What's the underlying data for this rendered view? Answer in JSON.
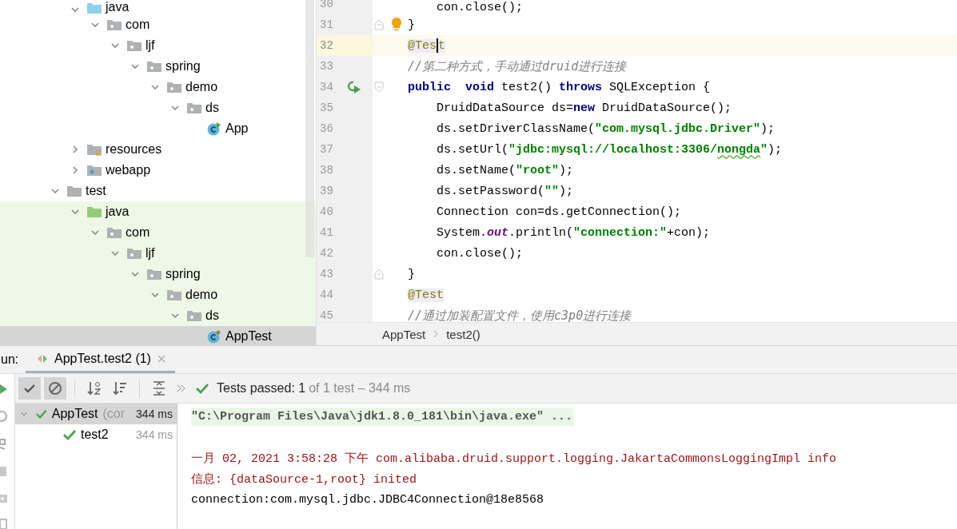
{
  "project_tree": {
    "items": [
      {
        "children": [
          {
            "label": "java",
            "kind": "source-root",
            "expanded": true,
            "selected": false,
            "children": [
              {
                "label": "com",
                "kind": "package",
                "expanded": true,
                "selected": false,
                "children": [
                  {
                    "label": "ljf",
                    "kind": "package",
                    "expanded": true,
                    "selected": false,
                    "children": [
                      {
                        "label": "spring",
                        "kind": "package",
                        "expanded": true,
                        "selected": false,
                        "children": [
                          {
                            "label": "demo",
                            "kind": "package",
                            "expanded": true,
                            "selected": false,
                            "children": [
                              {
                                "label": "ds",
                                "kind": "package",
                                "expanded": true,
                                "selected": false,
                                "children": [
                                  {
                                    "label": "App",
                                    "kind": "main-class",
                                    "selected": false
                                  }
                                ]
                              }
                            ]
                          }
                        ]
                      }
                    ]
                  }
                ]
              }
            ]
          },
          {
            "label": "resources",
            "kind": "resources",
            "expanded": false,
            "selected": false
          },
          {
            "label": "webapp",
            "kind": "webapp",
            "expanded": false,
            "selected": false
          }
        ]
      },
      {
        "label": "test",
        "kind": "folder",
        "expanded": true,
        "selected": false,
        "children": [
          {
            "label": "java",
            "kind": "test-root",
            "expanded": true,
            "selected": false,
            "children": [
              {
                "label": "com",
                "kind": "package",
                "expanded": true,
                "selected": false,
                "children": [
                  {
                    "label": "ljf",
                    "kind": "package",
                    "expanded": true,
                    "selected": false,
                    "children": [
                      {
                        "label": "spring",
                        "kind": "package",
                        "expanded": true,
                        "selected": false,
                        "children": [
                          {
                            "label": "demo",
                            "kind": "package",
                            "expanded": true,
                            "selected": false,
                            "children": [
                              {
                                "label": "ds",
                                "kind": "package",
                                "expanded": true,
                                "selected": false,
                                "children": [
                                  {
                                    "label": "AppTest",
                                    "kind": "test-class",
                                    "selected": true
                                  }
                                ]
                              }
                            ]
                          }
                        ]
                      }
                    ]
                  }
                ]
              }
            ]
          }
        ]
      }
    ]
  },
  "editor": {
    "lines": [
      {
        "number": "30",
        "current": false,
        "fold_start": false,
        "fold_end": false,
        "runnable": false,
        "bulb": false,
        "tokens": [
          {
            "kind": "plain",
            "text": "    con.close();"
          }
        ]
      },
      {
        "number": "31",
        "current": false,
        "fold_start": false,
        "fold_end": true,
        "runnable": false,
        "bulb": true,
        "tokens": [
          {
            "kind": "plain",
            "text": "}"
          }
        ]
      },
      {
        "number": "32",
        "current": true,
        "fold_start": false,
        "fold_end": false,
        "runnable": false,
        "bulb": false,
        "tokens": [
          {
            "kind": "annotation",
            "text": "@Tes"
          },
          {
            "kind": "caret"
          },
          {
            "kind": "annotation",
            "text": "t"
          }
        ]
      },
      {
        "number": "33",
        "current": false,
        "fold_start": false,
        "fold_end": false,
        "runnable": false,
        "bulb": false,
        "tokens": [
          {
            "kind": "comment",
            "text": "//第二种方式，手动通过druid进行连接"
          }
        ]
      },
      {
        "number": "34",
        "current": false,
        "fold_start": true,
        "fold_end": false,
        "runnable": true,
        "bulb": false,
        "tokens": [
          {
            "kind": "keyword",
            "text": "public  void"
          },
          {
            "kind": "plain",
            "text": " test2() "
          },
          {
            "kind": "keyword",
            "text": "throws"
          },
          {
            "kind": "plain",
            "text": " SQLException {"
          }
        ]
      },
      {
        "number": "35",
        "current": false,
        "fold_start": false,
        "fold_end": false,
        "runnable": false,
        "bulb": false,
        "tokens": [
          {
            "kind": "plain",
            "text": "    DruidDataSource ds="
          },
          {
            "kind": "keyword",
            "text": "new"
          },
          {
            "kind": "plain",
            "text": " DruidDataSource();"
          }
        ]
      },
      {
        "number": "36",
        "current": false,
        "fold_start": false,
        "fold_end": false,
        "runnable": false,
        "bulb": false,
        "tokens": [
          {
            "kind": "plain",
            "text": "    ds.setDriverClassName("
          },
          {
            "kind": "string",
            "text": "\"com.mysql.jdbc.Driver\""
          },
          {
            "kind": "plain",
            "text": ");"
          }
        ]
      },
      {
        "number": "37",
        "current": false,
        "fold_start": false,
        "fold_end": false,
        "runnable": false,
        "bulb": false,
        "tokens": [
          {
            "kind": "plain",
            "text": "    ds.setUrl("
          },
          {
            "kind": "string",
            "text": "\"jdbc:mysql://localhost:3306/"
          },
          {
            "kind": "string-misspelled",
            "text": "nongda"
          },
          {
            "kind": "string",
            "text": "\""
          },
          {
            "kind": "plain",
            "text": ");"
          }
        ]
      },
      {
        "number": "38",
        "current": false,
        "fold_start": false,
        "fold_end": false,
        "runnable": false,
        "bulb": false,
        "tokens": [
          {
            "kind": "plain",
            "text": "    ds.setName("
          },
          {
            "kind": "string",
            "text": "\"root\""
          },
          {
            "kind": "plain",
            "text": ");"
          }
        ]
      },
      {
        "number": "39",
        "current": false,
        "fold_start": false,
        "fold_end": false,
        "runnable": false,
        "bulb": false,
        "tokens": [
          {
            "kind": "plain",
            "text": "    ds.setPassword("
          },
          {
            "kind": "string",
            "text": "\"\""
          },
          {
            "kind": "plain",
            "text": ");"
          }
        ]
      },
      {
        "number": "40",
        "current": false,
        "fold_start": false,
        "fold_end": false,
        "runnable": false,
        "bulb": false,
        "tokens": [
          {
            "kind": "plain",
            "text": "    Connection con=ds.getConnection();"
          }
        ]
      },
      {
        "number": "41",
        "current": false,
        "fold_start": false,
        "fold_end": false,
        "runnable": false,
        "bulb": false,
        "tokens": [
          {
            "kind": "plain",
            "text": "    System."
          },
          {
            "kind": "field",
            "text": "out"
          },
          {
            "kind": "plain",
            "text": ".println("
          },
          {
            "kind": "string",
            "text": "\"connection:\""
          },
          {
            "kind": "plain",
            "text": "+con);"
          }
        ]
      },
      {
        "number": "42",
        "current": false,
        "fold_start": false,
        "fold_end": false,
        "runnable": false,
        "bulb": false,
        "tokens": [
          {
            "kind": "plain",
            "text": "    con.close();"
          }
        ]
      },
      {
        "number": "43",
        "current": false,
        "fold_start": false,
        "fold_end": true,
        "runnable": false,
        "bulb": false,
        "tokens": [
          {
            "kind": "plain",
            "text": "}"
          }
        ]
      },
      {
        "number": "44",
        "current": false,
        "fold_start": false,
        "fold_end": false,
        "runnable": false,
        "bulb": false,
        "tokens": [
          {
            "kind": "annotation",
            "text": "@Test"
          }
        ]
      },
      {
        "number": "45",
        "current": false,
        "fold_start": false,
        "fold_end": false,
        "runnable": false,
        "bulb": false,
        "tokens": [
          {
            "kind": "comment",
            "text": "//通过加装配置文件，使用c3p0进行连接"
          }
        ]
      }
    ],
    "breadcrumbs": [
      "AppTest",
      "test2()"
    ]
  },
  "run_panel": {
    "label": "un:",
    "tabs": [
      {
        "label": "AppTest.test2 (1)",
        "selected": true
      }
    ],
    "toolbar": [
      {
        "kind": "show-passed",
        "pressed": true
      },
      {
        "kind": "show-ignored",
        "pressed": true
      }
    ],
    "status": {
      "main": "Tests passed: 1",
      "detail": "of 1 test – 344 ms"
    },
    "results": [
      {
        "name": "AppTest",
        "suffix": "(cor",
        "time": "344 ms",
        "selected": true,
        "expanded": true,
        "children": [
          {
            "name": "test2",
            "time": "344 ms",
            "selected": false
          }
        ]
      }
    ],
    "console": [
      {
        "kind": "command",
        "text": "\"C:\\Program Files\\Java\\jdk1.8.0_181\\bin\\java.exe\" ..."
      },
      {
        "kind": "blank"
      },
      {
        "kind": "error",
        "text": "一月 02, 2021 3:58:28 下午 com.alibaba.druid.support.logging.JakartaCommonsLoggingImpl info"
      },
      {
        "kind": "error",
        "text": "信息: {dataSource-1,root} inited"
      },
      {
        "kind": "output",
        "text": "connection:com.mysql.jdbc.JDBC4Connection@18e8568"
      }
    ]
  }
}
